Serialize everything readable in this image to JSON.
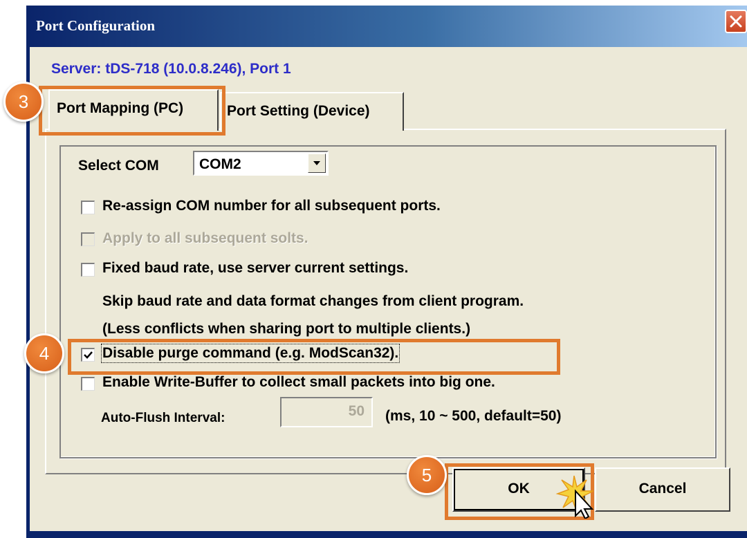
{
  "window": {
    "title": "Port Configuration",
    "close_label": "×"
  },
  "server_line": "Server: tDS-718 (10.0.8.246), Port 1",
  "tabs": [
    {
      "label": "Port Mapping (PC)",
      "active": true
    },
    {
      "label": "Port Setting (Device)",
      "active": false
    }
  ],
  "select_com": {
    "label": "Select COM",
    "value": "COM2"
  },
  "options": [
    {
      "label": "Re-assign COM number for all subsequent ports.",
      "checked": false,
      "enabled": true
    },
    {
      "label": "Apply to all subsequent solts.",
      "checked": false,
      "enabled": false
    },
    {
      "label": "Fixed baud rate, use server current settings.",
      "checked": false,
      "enabled": true
    },
    {
      "label": "Disable purge command (e.g. ModScan32).",
      "checked": true,
      "enabled": true
    },
    {
      "label": "Enable Write-Buffer to collect small packets into big one.",
      "checked": false,
      "enabled": true
    }
  ],
  "notes": [
    "Skip baud rate and data format changes from client program.",
    "(Less conflicts when sharing port to multiple clients.)"
  ],
  "auto_flush": {
    "label": "Auto-Flush Interval:",
    "value": "50",
    "hint": "(ms, 10 ~ 500, default=50)"
  },
  "buttons": {
    "ok": "OK",
    "cancel": "Cancel"
  },
  "callouts": [
    "3",
    "4",
    "5"
  ],
  "colors": {
    "highlight": "#e07a2e",
    "badge": "#e07a2e",
    "title_bar": "#0a246a",
    "server_text": "#2d2dc8",
    "dialog_bg": "#ece9d8"
  }
}
